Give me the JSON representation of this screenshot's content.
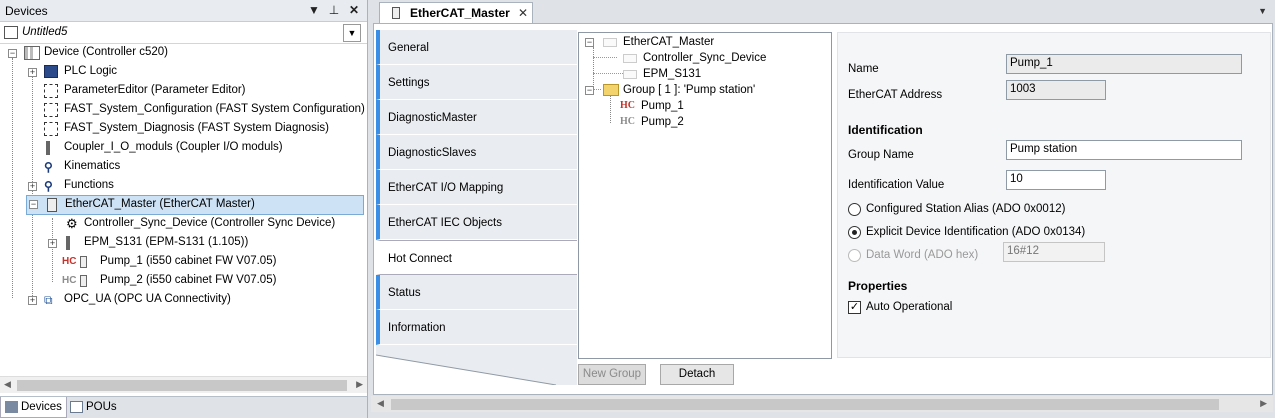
{
  "left_panel": {
    "title": "Devices",
    "pin_icon": "pin-icon",
    "dropdown_icon": "chevron-down-icon",
    "close_icon": "close-icon",
    "project": "Untitled5",
    "tree": {
      "device": "Device (Controller c520)",
      "plc_logic": "PLC Logic",
      "parameter_editor": "ParameterEditor (Parameter Editor)",
      "fast_config": "FAST_System_Configuration (FAST System Configuration)",
      "fast_diag": "FAST_System_Diagnosis (FAST System Diagnosis)",
      "coupler": "Coupler_I_O_moduls (Coupler I/O moduls)",
      "kinematics": "Kinematics",
      "functions": "Functions",
      "ethercat_master": "EtherCAT_Master (EtherCAT Master)",
      "controller_sync": "Controller_Sync_Device (Controller Sync Device)",
      "epm": "EPM_S131 (EPM-S131 (1.105))",
      "pump1": "Pump_1 (i550 cabinet FW V07.05)",
      "pump2": "Pump_2 (i550 cabinet FW V07.05)",
      "opc_ua": "OPC_UA (OPC UA Connectivity)"
    },
    "tabs": {
      "devices": "Devices",
      "pous": "POUs"
    }
  },
  "editor": {
    "tab_title": "EtherCAT_Master",
    "close_glyph": "✕",
    "vtabs": [
      "General",
      "Settings",
      "DiagnosticMaster",
      "DiagnosticSlaves",
      "EtherCAT I/O Mapping",
      "EtherCAT IEC Objects",
      "Hot Connect",
      "Status",
      "Information"
    ],
    "active_tab": "Hot Connect",
    "hc_tree": {
      "master": "EtherCAT_Master",
      "sync": "Controller_Sync_Device",
      "epm": "EPM_S131",
      "group": "Group [ 1 ]: 'Pump station'",
      "pump1": "Pump_1",
      "pump2": "Pump_2",
      "hc_label": "HC"
    },
    "buttons": {
      "new_group": "New Group",
      "detach": "Detach"
    },
    "props": {
      "name_label": "Name",
      "name_value": "Pump_1",
      "address_label": "EtherCAT Address",
      "address_value": "1003",
      "identification_heading": "Identification",
      "group_name_label": "Group Name",
      "group_name_value": "Pump station",
      "id_value_label": "Identification Value",
      "id_value": "10",
      "radio_alias": "Configured Station Alias (ADO 0x0012)",
      "radio_explicit": "Explicit Device Identification (ADO 0x0134)",
      "radio_dataword": "Data Word (ADO hex)",
      "dataword_value": "16#12",
      "properties_heading": "Properties",
      "auto_operational": "Auto Operational"
    }
  }
}
